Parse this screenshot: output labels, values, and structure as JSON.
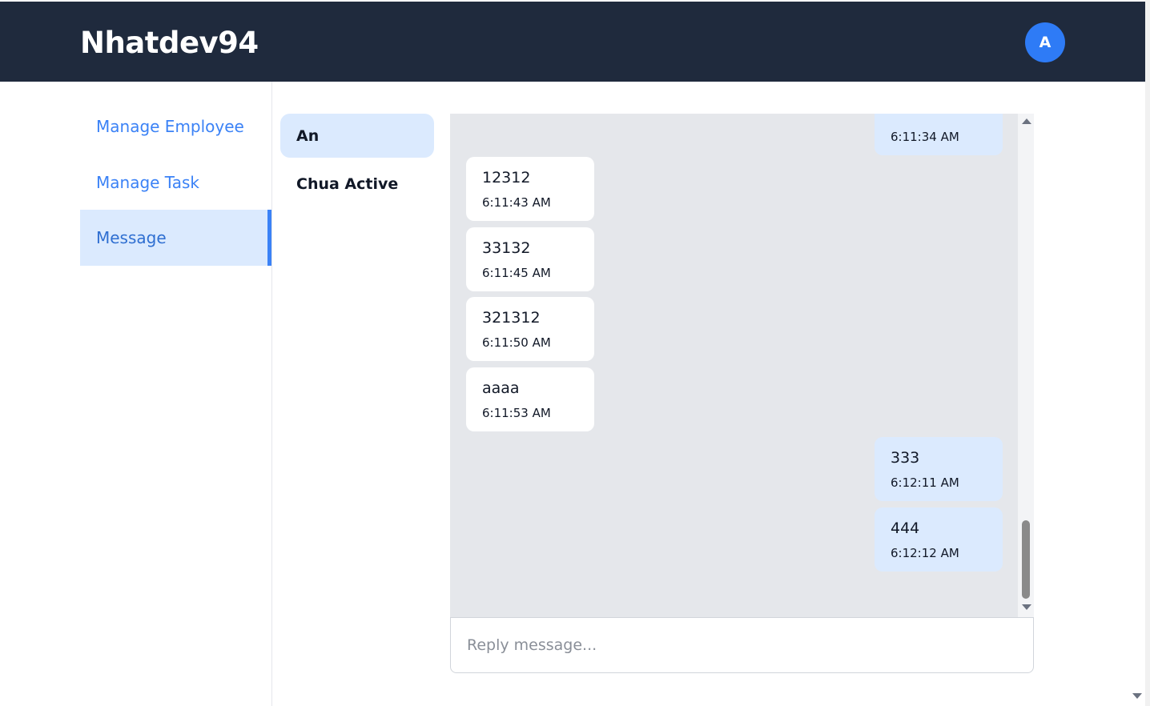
{
  "header": {
    "brand": "Nhatdev94",
    "avatar_initial": "A"
  },
  "sidebar": {
    "items": [
      {
        "label": "Manage Employee",
        "active": false
      },
      {
        "label": "Manage Task",
        "active": false
      },
      {
        "label": "Message",
        "active": true
      }
    ]
  },
  "contacts": [
    {
      "name": "An",
      "active": true
    },
    {
      "name": "Chua Active",
      "active": false
    }
  ],
  "chat": {
    "messages": [
      {
        "direction": "out",
        "text": "",
        "time": "6:11:34 AM"
      },
      {
        "direction": "in",
        "text": "12312",
        "time": "6:11:43 AM"
      },
      {
        "direction": "in",
        "text": "33132",
        "time": "6:11:45 AM"
      },
      {
        "direction": "in",
        "text": "321312",
        "time": "6:11:50 AM"
      },
      {
        "direction": "in",
        "text": "aaaa",
        "time": "6:11:53 AM"
      },
      {
        "direction": "out",
        "text": "333",
        "time": "6:12:11 AM"
      },
      {
        "direction": "out",
        "text": "444",
        "time": "6:12:12 AM"
      }
    ]
  },
  "reply": {
    "placeholder": "Reply message..."
  },
  "colors": {
    "header_bg": "#1f2a3d",
    "accent": "#3b82f6",
    "active_bg": "#dbeafe",
    "chat_bg": "#e5e7eb"
  }
}
